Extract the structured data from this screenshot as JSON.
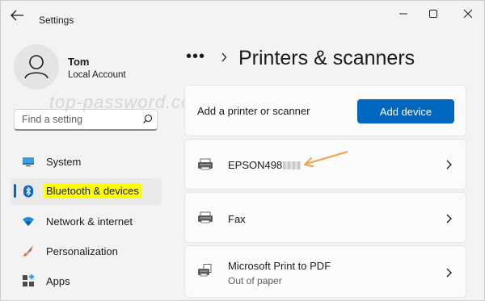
{
  "window": {
    "title": "Settings"
  },
  "account": {
    "name": "Tom",
    "type": "Local Account"
  },
  "search": {
    "placeholder": "Find a setting"
  },
  "sidebar": {
    "items": [
      {
        "label": "System",
        "icon": "display-icon",
        "selected": false
      },
      {
        "label": "Bluetooth & devices",
        "icon": "bluetooth-icon",
        "selected": true
      },
      {
        "label": "Network & internet",
        "icon": "wifi-icon",
        "selected": false
      },
      {
        "label": "Personalization",
        "icon": "brush-icon",
        "selected": false
      },
      {
        "label": "Apps",
        "icon": "apps-icon",
        "selected": false
      }
    ]
  },
  "header": {
    "more": "•••",
    "title": "Printers & scanners"
  },
  "watermark": "top-password.com",
  "add_printer": {
    "label": "Add a printer or scanner",
    "button": "Add device"
  },
  "printers": [
    {
      "name": "EPSON498",
      "status": "",
      "icon": "printer-icon"
    },
    {
      "name": "Fax",
      "status": "",
      "icon": "fax-icon"
    },
    {
      "name": "Microsoft Print to PDF",
      "status": "Out of paper",
      "icon": "pdf-printer-icon"
    }
  ],
  "colors": {
    "accent": "#0067c0",
    "highlight": "#ffff00",
    "annotation_arrow": "#f5a04a"
  }
}
